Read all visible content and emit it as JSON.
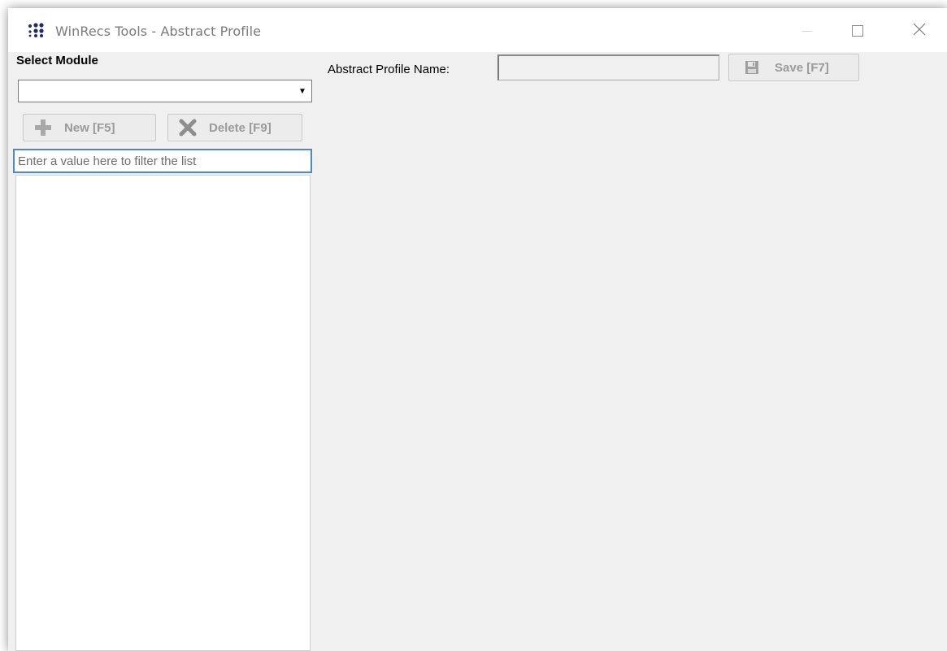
{
  "window": {
    "title": "WinRecs Tools - Abstract Profile",
    "app_icon": "winrecs-dots-icon",
    "controls": {
      "minimize_icon": "minimize-icon",
      "maximize_icon": "maximize-icon",
      "close_icon": "close-icon",
      "close_glyph": "✕"
    }
  },
  "sidebar": {
    "select_module_label": "Select Module",
    "module_select_value": "",
    "dropdown_glyph": "▼",
    "new_button": {
      "label": "New [F5]",
      "icon": "plus-icon"
    },
    "delete_button": {
      "label": "Delete [F9]",
      "icon": "delete-x-icon"
    },
    "filter_placeholder": "Enter a value here to filter the list",
    "filter_value": "",
    "list_items": []
  },
  "main": {
    "profile_name_label": "Abstract Profile Name:",
    "profile_name_value": "",
    "save_button": {
      "label": "Save [F7]",
      "icon": "floppy-disk-icon"
    }
  },
  "colors": {
    "accent_focus": "#4a88d0",
    "window_bg": "#f0f0f0",
    "icon_dark_blue": "#1f2a6b",
    "disabled_text": "#9a9a9a"
  }
}
